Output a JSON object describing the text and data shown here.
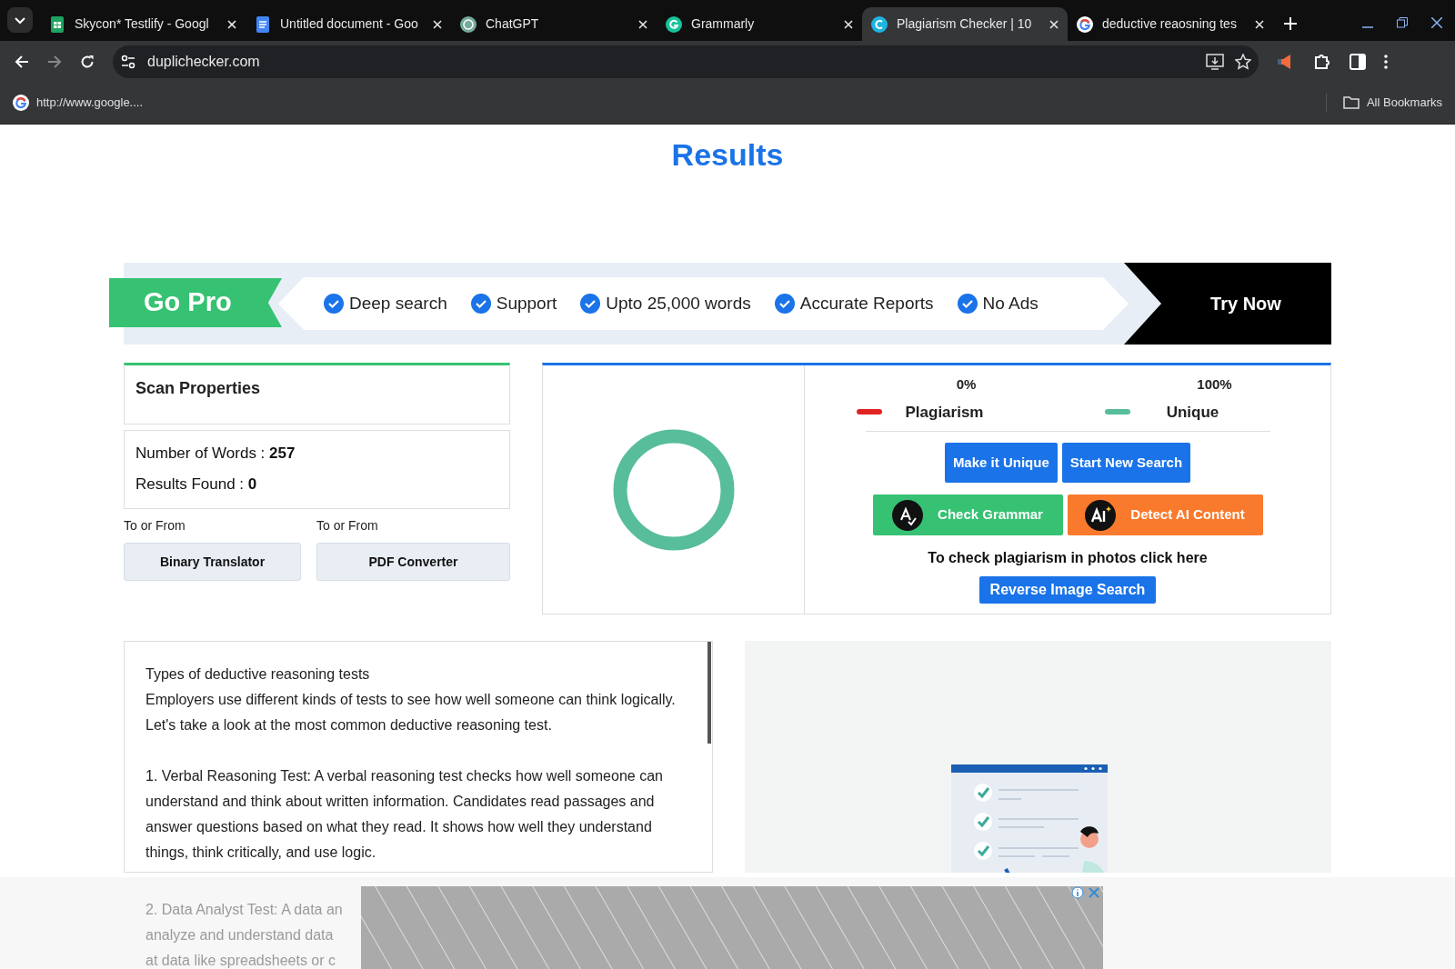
{
  "browser": {
    "tabs": [
      {
        "title": "Skycon* Testlify - Googl",
        "selected": false
      },
      {
        "title": "Untitled document - Goo",
        "selected": false
      },
      {
        "title": "ChatGPT",
        "selected": false
      },
      {
        "title": "Grammarly",
        "selected": false
      },
      {
        "title": "Plagiarism Checker | 10",
        "selected": true
      },
      {
        "title": "deductive reaosning tes",
        "selected": false
      }
    ],
    "url": "duplichecker.com",
    "bookmarks": [
      {
        "label": "http://www.google...."
      }
    ],
    "all_bookmarks": "All Bookmarks"
  },
  "heading": {
    "title": "Results"
  },
  "promo": {
    "badge": "Go Pro",
    "features": [
      "Deep search",
      "Support",
      "Upto 25,000 words",
      "Accurate Reports",
      "No Ads"
    ],
    "cta": "Try Now"
  },
  "scan": {
    "title": "Scan Properties",
    "stats": [
      {
        "label": "Number of Words : ",
        "value": "257"
      },
      {
        "label": "Results Found : ",
        "value": "0"
      }
    ],
    "tools": [
      {
        "caption": "To or From",
        "button": "Binary Translator"
      },
      {
        "caption": "To or From",
        "button": "PDF Converter"
      }
    ]
  },
  "result": {
    "legend": [
      {
        "percent": "0%",
        "label": "Plagiarism",
        "color": "#e02424"
      },
      {
        "percent": "100%",
        "label": "Unique",
        "color": "#58bd9a"
      }
    ],
    "buttons": [
      {
        "label": "Make it Unique",
        "kind": "plain"
      },
      {
        "label": "Start New Search",
        "kind": "plain"
      },
      {
        "label": "Check Grammar",
        "kind": "grammar"
      },
      {
        "label": "Detect AI Content",
        "kind": "ai"
      }
    ],
    "photo_note": "To check plagiarism in photos click here",
    "reverse_button": "Reverse Image Search"
  },
  "document": {
    "paragraphs": [
      "Types of deductive reasoning tests\nEmployers use different kinds of tests to see how well someone can think logically. Let's take a look at the most common deductive reasoning test.",
      "1. Verbal Reasoning Test: A verbal reasoning test checks how well someone can understand and think about written information. Candidates read passages and answer questions based on what they read. It shows how well they understand things, think critically, and use logic."
    ],
    "faded_lines": [
      "2. Data Analyst Test: A data an",
      "analyze and understand data",
      "at data like spreadsheets or c"
    ]
  }
}
